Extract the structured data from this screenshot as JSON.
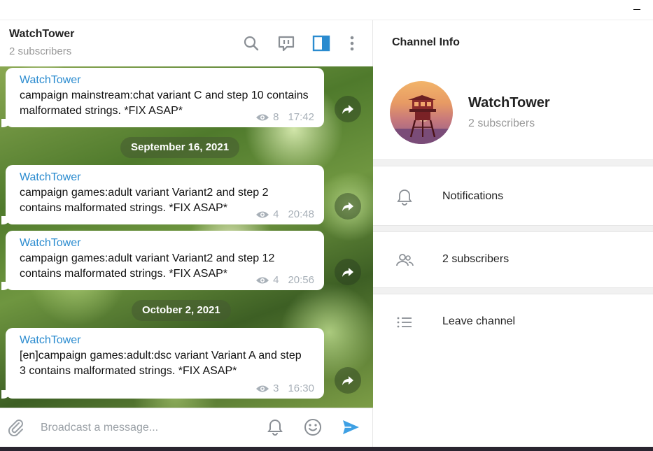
{
  "chat": {
    "title": "WatchTower",
    "subtitle": "2 subscribers"
  },
  "header_icons": [
    "search-icon",
    "discussion-icon",
    "sidebar-toggle-icon",
    "more-vertical-icon"
  ],
  "messages": [
    {
      "author": "WatchTower",
      "text": "campaign mainstream:chat variant C and step 10 contains malformated strings. *FIX ASAP*",
      "views": "8",
      "time": "17:42"
    },
    {
      "author": "WatchTower",
      "text": "campaign games:adult variant Variant2 and step 2 contains malformated strings. *FIX ASAP*",
      "views": "4",
      "time": "20:48"
    },
    {
      "author": "WatchTower",
      "text": "campaign games:adult variant Variant2 and step 12 contains malformated strings. *FIX ASAP*",
      "views": "4",
      "time": "20:56"
    },
    {
      "author": "WatchTower",
      "text": "[en]campaign games:adult:dsc variant Variant A and step 3 contains malformated strings. *FIX ASAP*",
      "views": "3",
      "time": "16:30"
    }
  ],
  "dates": [
    "September 16, 2021",
    "October 2, 2021"
  ],
  "composer": {
    "placeholder": "Broadcast a message..."
  },
  "info": {
    "title": "Channel Info",
    "name": "WatchTower",
    "subtitle": "2 subscribers",
    "rows": [
      {
        "label": "Notifications",
        "icon": "bell-icon"
      },
      {
        "label": "2 subscribers",
        "icon": "users-icon"
      },
      {
        "label": "Leave channel",
        "icon": "list-icon"
      }
    ]
  },
  "colors": {
    "accent": "#2a8bcf",
    "send": "#3ea0e4",
    "meta": "#a8b0b8"
  }
}
